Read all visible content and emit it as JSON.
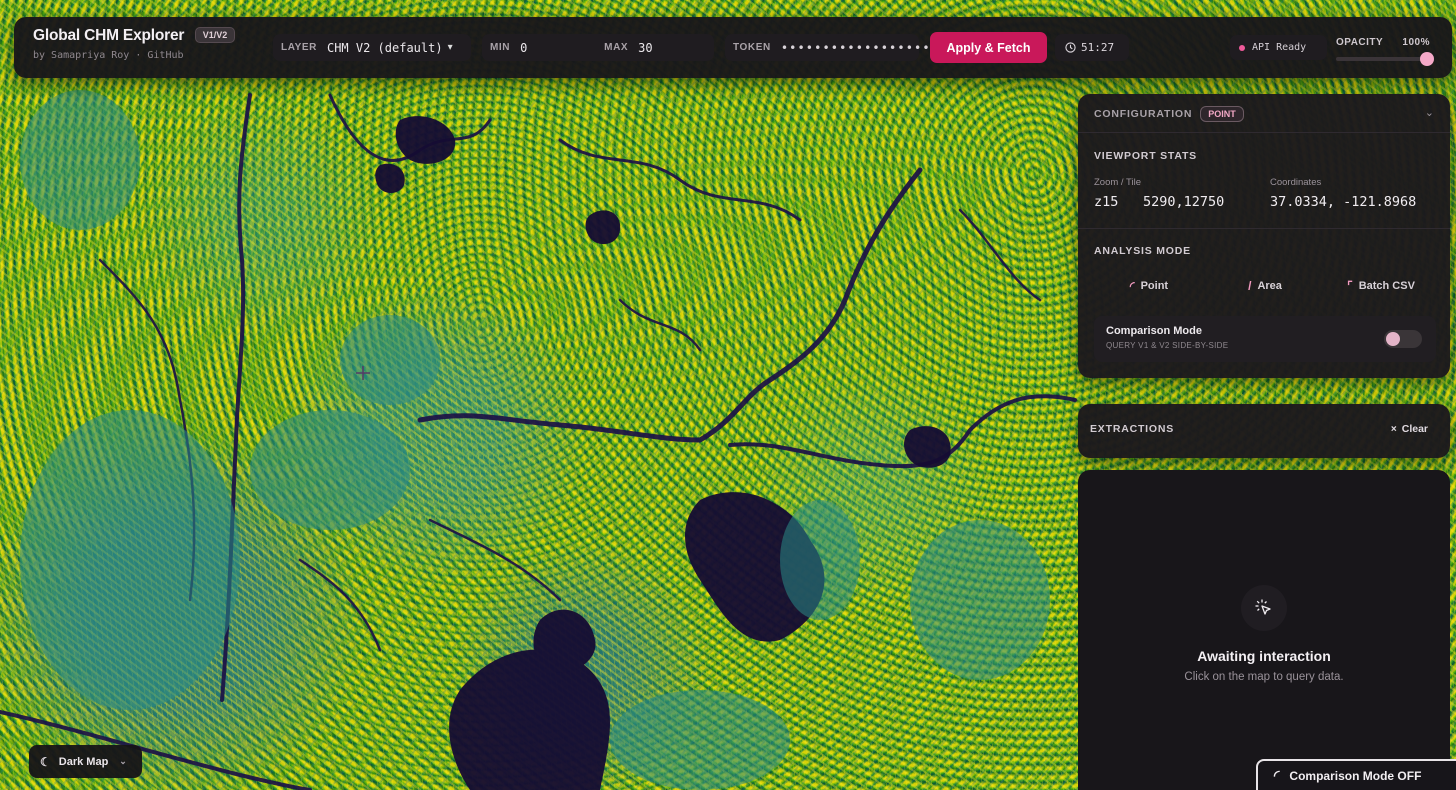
{
  "header": {
    "title": "Global CHM Explorer",
    "version_badge": "V1/V2",
    "byline": "by Samapriya Roy · GitHub",
    "layer_label": "LAYER",
    "layer_value": "CHM V2 (default)",
    "min_label": "MIN",
    "min_value": "0",
    "max_label": "MAX",
    "max_value": "30",
    "token_label": "TOKEN",
    "token_value": "••••••••••••••••••",
    "apply_button": "Apply & Fetch",
    "timer": "51:27",
    "api_status": "API Ready",
    "opacity_label": "OPACITY",
    "opacity_value": "100%",
    "opacity_level": 1.0
  },
  "config": {
    "title": "CONFIGURATION",
    "mode_badge": "POINT",
    "viewport_title": "VIEWPORT STATS",
    "zoom_label": "Zoom / Tile",
    "zoom_value": "z15",
    "tile_value": "5290,12750",
    "coords_label": "Coordinates",
    "coords_value": "37.0334, -121.8968",
    "analysis_title": "ANALYSIS MODE",
    "modes": [
      "Point",
      "Area",
      "Batch CSV"
    ],
    "comparison_title": "Comparison Mode",
    "comparison_sub": "QUERY V1 & V2 SIDE-BY-SIDE",
    "comparison_on": false
  },
  "extractions": {
    "title": "EXTRACTIONS",
    "clear_button": "Clear",
    "empty_title": "Awaiting interaction",
    "empty_sub": "Click on the map to query data."
  },
  "basemap_button": "Dark Map",
  "comparison_status": "Comparison Mode OFF",
  "colors": {
    "accent": "#c9185a",
    "accent_light": "#f29ac0",
    "panel_bg": "#1c191d",
    "map_high": "#e8e42a",
    "map_mid": "#2d9a7e",
    "map_low": "#1a1040"
  },
  "icons": {
    "layer_dropdown": "chevron-down-icon",
    "timer": "clock-icon",
    "config_collapse": "chevron-down-icon",
    "point_mode": "point-arc-icon",
    "area_mode": "pencil-icon",
    "batch_mode": "corner-icon",
    "clear": "close-icon",
    "empty": "cursor-click-icon",
    "basemap": "moon-icon",
    "comparison": "arc-icon",
    "map_cursor": "crosshair-icon"
  }
}
